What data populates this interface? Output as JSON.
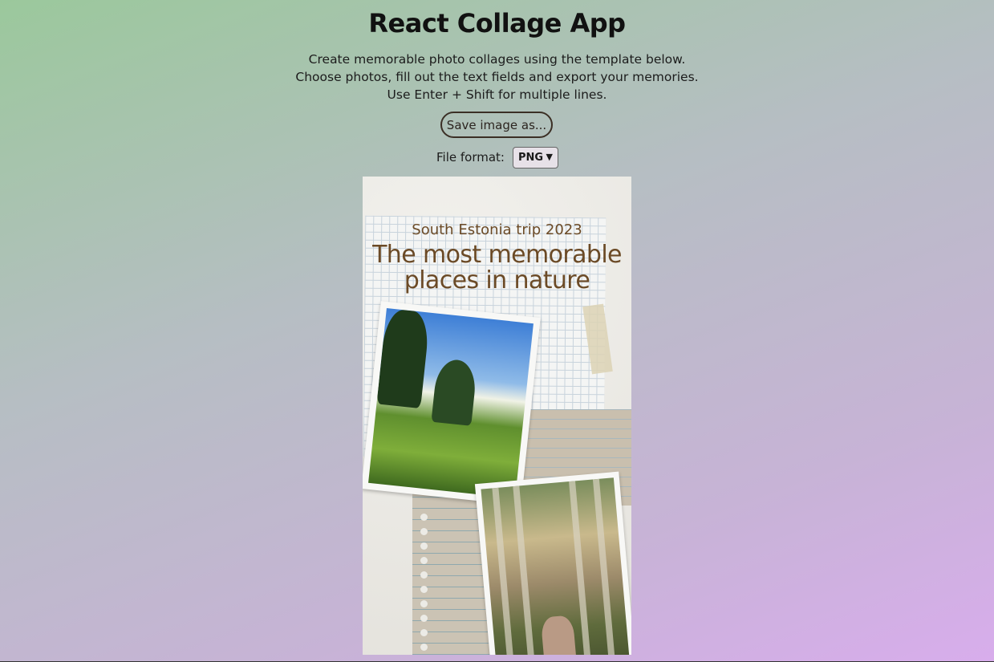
{
  "app": {
    "title": "React Collage App",
    "description_lines": [
      "Create memorable photo collages using the template below.",
      "Choose photos, fill out the text fields and export your memories.",
      "Use Enter + Shift for multiple lines."
    ],
    "save_button_label": "Save image as...",
    "file_format_label": "File format:",
    "file_format_selected": "PNG"
  },
  "collage": {
    "subtitle": "South Estonia trip 2023",
    "headline_lines": [
      "The most memorable",
      "places in nature"
    ],
    "photos": [
      {
        "name": "photo-meadow",
        "icon": "image-icon"
      },
      {
        "name": "photo-forest",
        "icon": "image-icon"
      }
    ]
  },
  "colors": {
    "accent_text": "#6b4a26",
    "button_border": "#3b2f25"
  }
}
